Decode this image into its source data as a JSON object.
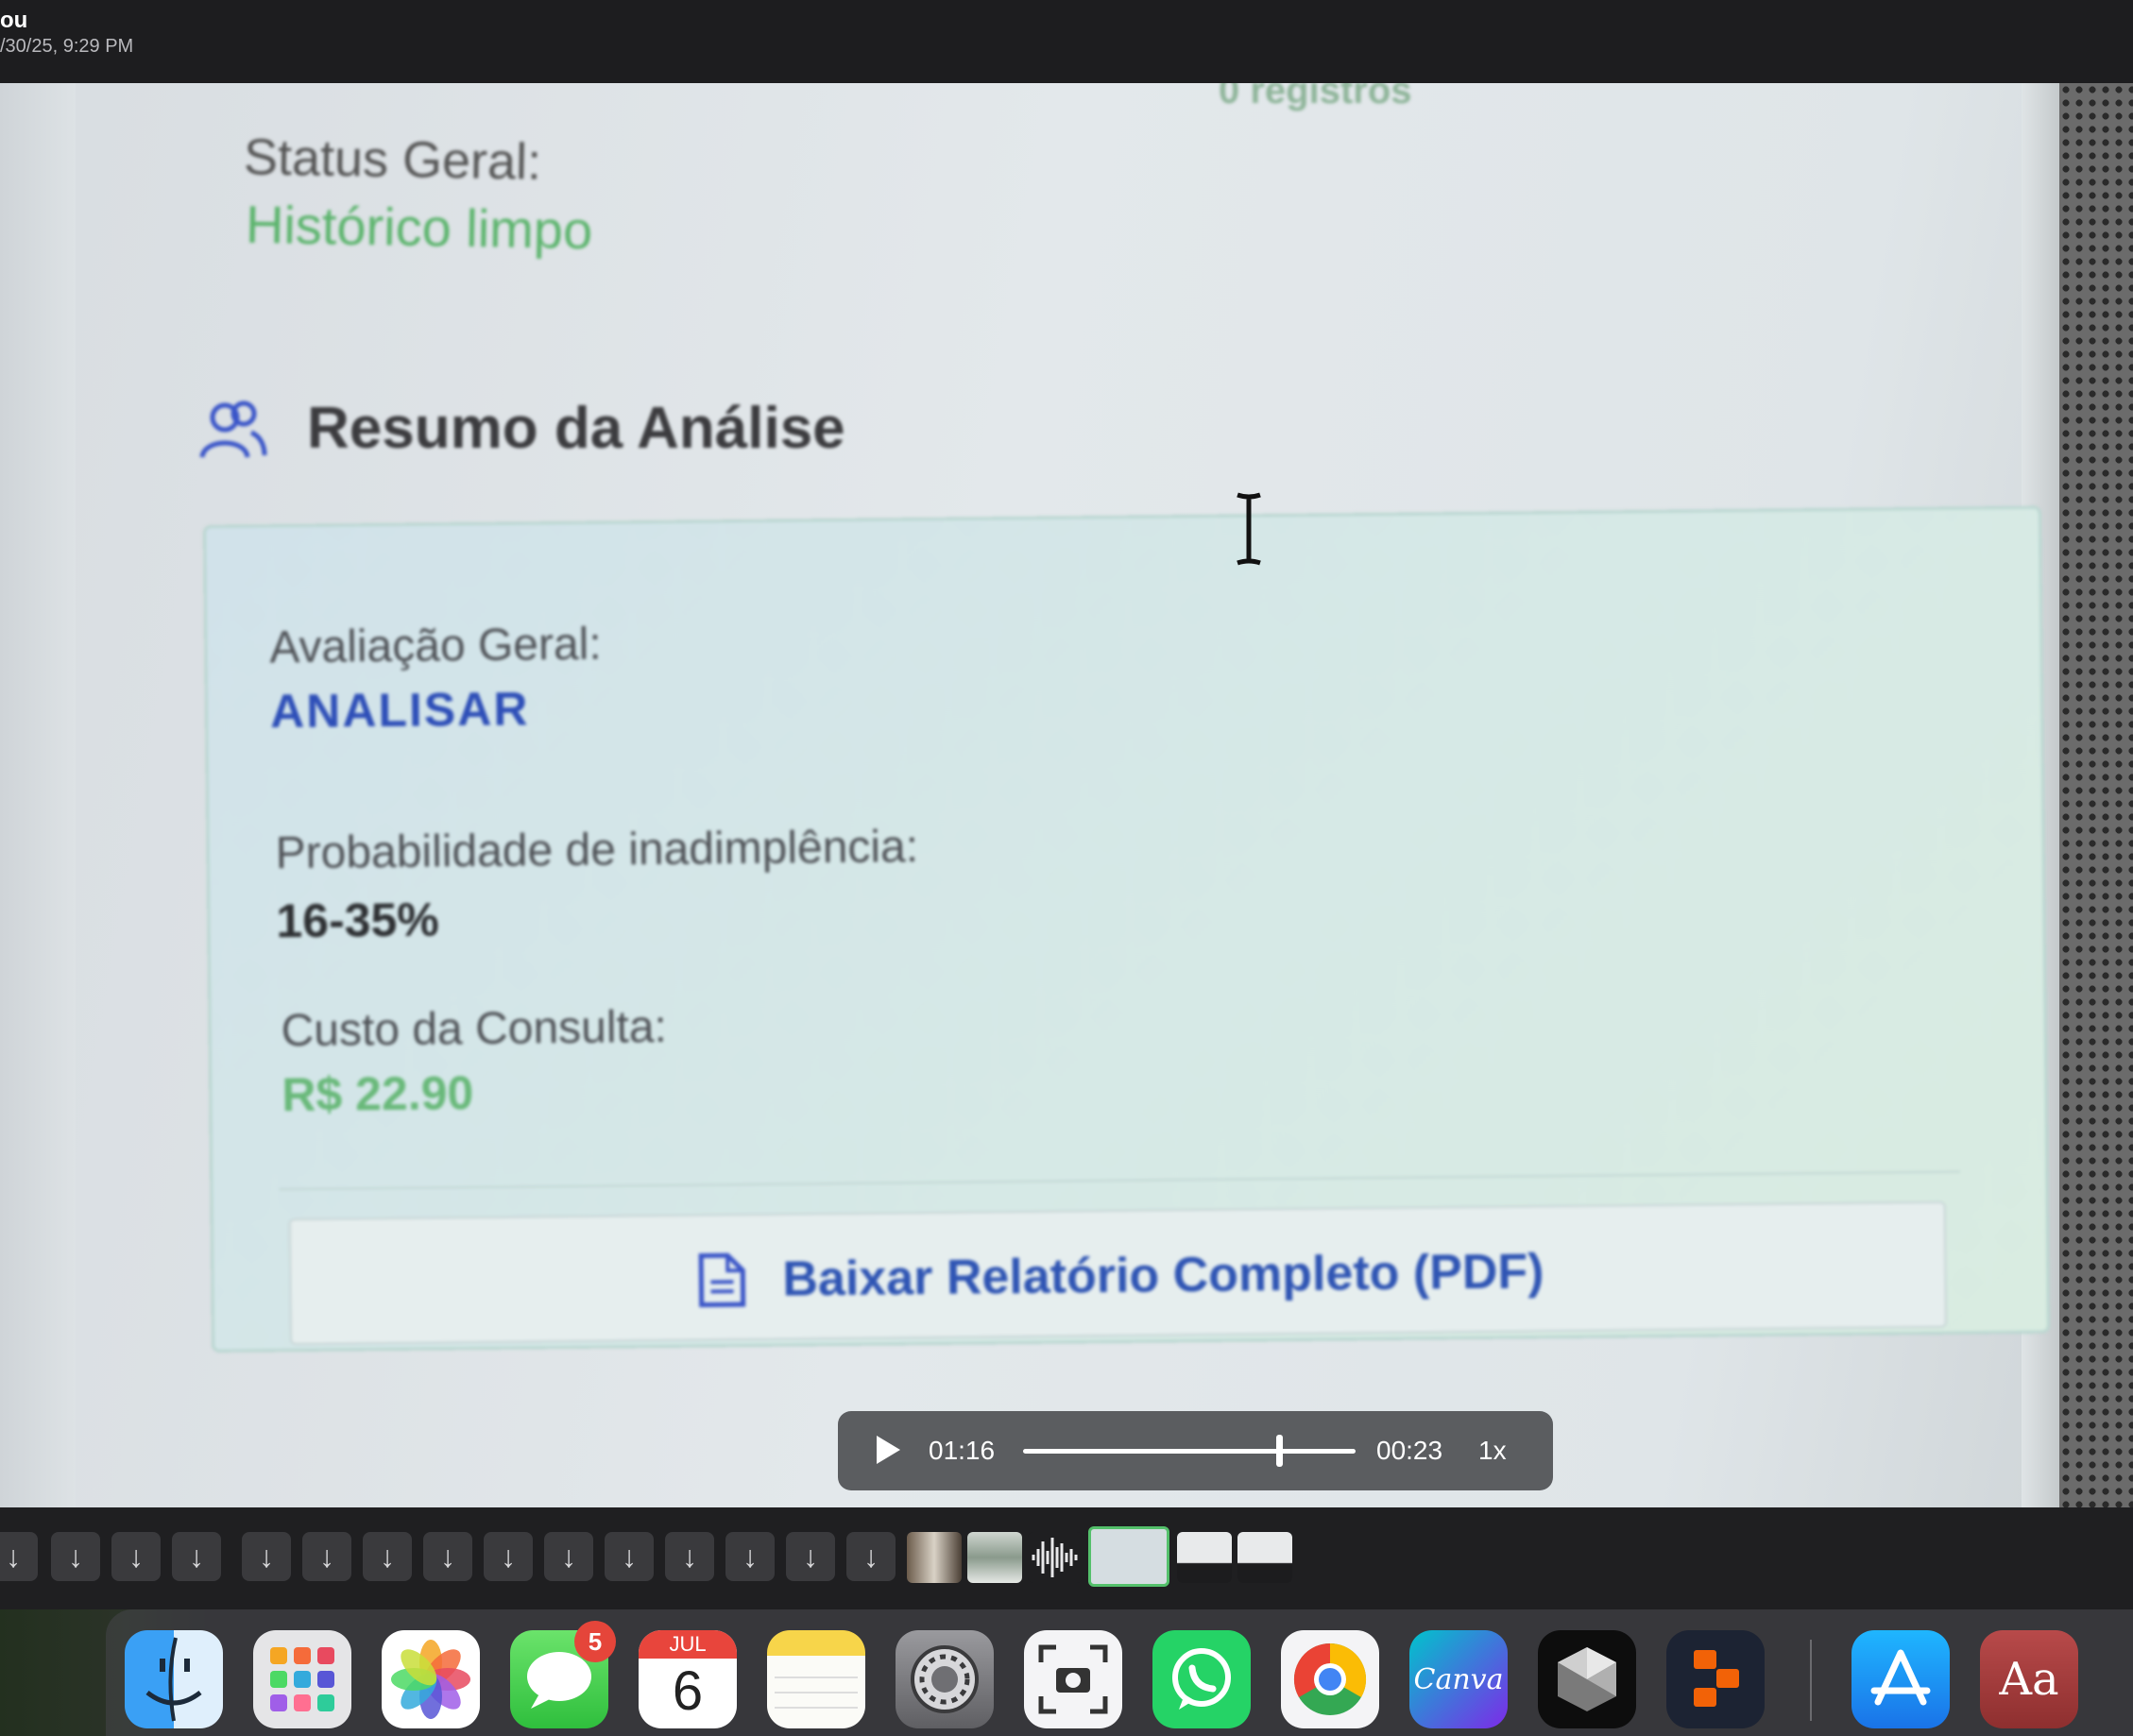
{
  "header": {
    "sender": "ou",
    "timestamp": "/30/25, 9:29 PM"
  },
  "photo": {
    "faded_top_text": "0 registros",
    "status_label": "Status Geral:",
    "status_value": "Histórico limpo",
    "section_title": "Resumo da Análise",
    "summary": {
      "evaluation_label": "Avaliação Geral:",
      "evaluation_value": "ANALISAR",
      "default_prob_label": "Probabilidade de inadimplência:",
      "default_prob_value": "16-35%",
      "cost_label": "Custo da Consulta:",
      "cost_value": "R$ 22.90"
    },
    "pdf_button_label": "Baixar Relatório Completo (PDF)"
  },
  "player": {
    "current_time": "01:16",
    "remaining_time": "00:23",
    "speed": "1x",
    "progress_fraction": 0.77
  },
  "filmstrip": {
    "download_glyph": "↓",
    "download_count": 15
  },
  "dock": {
    "apps": [
      "Finder",
      "Launchpad",
      "Photos",
      "Messages",
      "Calendar",
      "Notes",
      "System Settings",
      "Screenshot",
      "WhatsApp",
      "Chrome",
      "Canva",
      "Cursor",
      "Replit",
      "App Store",
      "Dictionary"
    ],
    "messages_badge": "5",
    "calendar_month": "JUL",
    "calendar_day": "6",
    "canva_label": "Canva",
    "dictionary_label": "Aa"
  },
  "colors": {
    "accent_blue": "#2f55b4",
    "status_green": "#5cb46d",
    "selection_green": "#54c06b",
    "badge_red": "#e5453a"
  }
}
